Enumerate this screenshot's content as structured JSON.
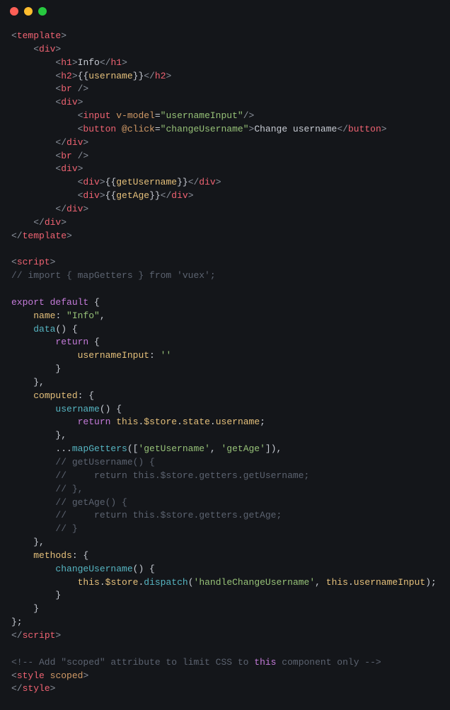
{
  "titlebar": {
    "dots": [
      "red",
      "yellow",
      "green"
    ]
  },
  "code": {
    "l1a": "<",
    "l1b": "template",
    "l1c": ">",
    "l2a": "    <",
    "l2b": "div",
    "l2c": ">",
    "l3a": "        <",
    "l3b": "h1",
    "l3c": ">",
    "l3d": "Info",
    "l3e": "</",
    "l3f": "h1",
    "l3g": ">",
    "l4a": "        <",
    "l4b": "h2",
    "l4c": ">",
    "l4d": "{{",
    "l4e": "username",
    "l4f": "}}",
    "l4g": "</",
    "l4h": "h2",
    "l4i": ">",
    "l5a": "        <",
    "l5b": "br",
    "l5c": " />",
    "l6a": "        <",
    "l6b": "div",
    "l6c": ">",
    "l7a": "            <",
    "l7b": "input",
    "l7c": " ",
    "l7d": "v-model",
    "l7e": "=",
    "l7f": "\"usernameInput\"",
    "l7g": "/>",
    "l8a": "            <",
    "l8b": "button",
    "l8c": " ",
    "l8d": "@click",
    "l8e": "=",
    "l8f": "\"changeUsername\"",
    "l8g": ">",
    "l8h": "Change username",
    "l8i": "</",
    "l8j": "button",
    "l8k": ">",
    "l9a": "        </",
    "l9b": "div",
    "l9c": ">",
    "l10a": "        <",
    "l10b": "br",
    "l10c": " />",
    "l11a": "        <",
    "l11b": "div",
    "l11c": ">",
    "l12a": "            <",
    "l12b": "div",
    "l12c": ">",
    "l12d": "{{",
    "l12e": "getUsername",
    "l12f": "}}",
    "l12g": "</",
    "l12h": "div",
    "l12i": ">",
    "l13a": "            <",
    "l13b": "div",
    "l13c": ">",
    "l13d": "{{",
    "l13e": "getAge",
    "l13f": "}}",
    "l13g": "</",
    "l13h": "div",
    "l13i": ">",
    "l14a": "        </",
    "l14b": "div",
    "l14c": ">",
    "l15a": "    </",
    "l15b": "div",
    "l15c": ">",
    "l16a": "</",
    "l16b": "template",
    "l16c": ">",
    "blank1": "",
    "l17a": "<",
    "l17b": "script",
    "l17c": ">",
    "l18": "// import { mapGetters } from 'vuex';",
    "blank2": "",
    "l19a": "export default",
    "l19b": " {",
    "l20a": "    ",
    "l20b": "name",
    "l20c": ": ",
    "l20d": "\"Info\"",
    "l20e": ",",
    "l21a": "    ",
    "l21b": "data",
    "l21c": "() {",
    "l22a": "        ",
    "l22b": "return",
    "l22c": " {",
    "l23a": "            ",
    "l23b": "usernameInput",
    "l23c": ": ",
    "l23d": "''",
    "l24": "        }",
    "l25": "    },",
    "l26a": "    ",
    "l26b": "computed",
    "l26c": ": {",
    "l27a": "        ",
    "l27b": "username",
    "l27c": "() {",
    "l28a": "            ",
    "l28b": "return",
    "l28c": " ",
    "l28d": "this",
    "l28e": ".",
    "l28f": "$store",
    "l28g": ".",
    "l28h": "state",
    "l28i": ".",
    "l28j": "username",
    "l28k": ";",
    "l29": "        },",
    "l30a": "        ...",
    "l30b": "mapGetters",
    "l30c": "([",
    "l30d": "'getUsername'",
    "l30e": ", ",
    "l30f": "'getAge'",
    "l30g": "]),",
    "l31": "        // getUsername() {",
    "l32": "        //     return this.$store.getters.getUsername;",
    "l33": "        // },",
    "l34": "        // getAge() {",
    "l35": "        //     return this.$store.getters.getAge;",
    "l36": "        // }",
    "l37": "    },",
    "l38a": "    ",
    "l38b": "methods",
    "l38c": ": {",
    "l39a": "        ",
    "l39b": "changeUsername",
    "l39c": "() {",
    "l40a": "            ",
    "l40b": "this",
    "l40c": ".",
    "l40d": "$store",
    "l40e": ".",
    "l40f": "dispatch",
    "l40g": "(",
    "l40h": "'handleChangeUsername'",
    "l40i": ", ",
    "l40j": "this",
    "l40k": ".",
    "l40l": "usernameInput",
    "l40m": ");",
    "l41": "        }",
    "l42": "    }",
    "l43": "};",
    "l44a": "</",
    "l44b": "script",
    "l44c": ">",
    "blank3": "",
    "l45a": "<!-- Add \"scoped\" attribute to limit CSS to ",
    "l45b": "this",
    "l45c": " component only -->",
    "l46a": "<",
    "l46b": "style",
    "l46c": " ",
    "l46d": "scoped",
    "l46e": ">",
    "l47a": "</",
    "l47b": "style",
    "l47c": ">"
  }
}
